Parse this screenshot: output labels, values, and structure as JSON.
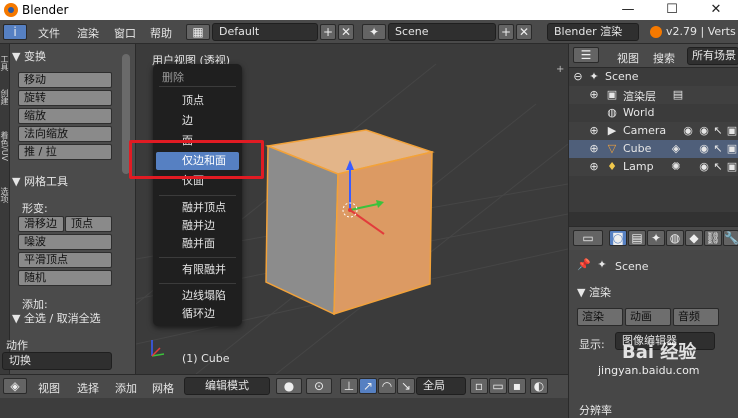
{
  "window": {
    "title": "Blender",
    "min_glyph": "—",
    "max_glyph": "☐",
    "close_glyph": "✕"
  },
  "topbar": {
    "info_glyph": "i",
    "menu": [
      "文件",
      "渲染",
      "窗口",
      "帮助"
    ],
    "layout_value": "Default",
    "scene_value": "Scene",
    "engine_value": "Blender 渲染",
    "version": "v2.79 | Verts",
    "plus": "+",
    "x": "✕"
  },
  "toolshelf": {
    "tabs": [
      "工具",
      "创建",
      "着色/UV",
      "选项"
    ],
    "transform_header": "▼ 变换",
    "transform_buttons": [
      "移动",
      "旋转",
      "缩放",
      "法向缩放",
      "推 / 拉"
    ],
    "mesh_tools_header": "▼ 网格工具",
    "deform_label": "形变:",
    "deform_buttons": [
      "滑移边",
      "顶点",
      "噪波",
      "平滑顶点",
      "随机"
    ],
    "add_label": "添加:",
    "select_header": "▼ 全选 / 取消全选",
    "action_label": "动作",
    "action_value": "切换"
  },
  "viewport": {
    "title": "用户视图 (透视)",
    "object_label": "(1) Cube"
  },
  "delete_menu": {
    "title": "删除",
    "items": [
      "顶点",
      "边",
      "面",
      "仅边和面",
      "仅面",
      "融并顶点",
      "融并边",
      "融并面",
      "有限融并",
      "边线塌陷",
      "循环边"
    ],
    "active_index": 3
  },
  "bottombar": {
    "menu": [
      "视图",
      "选择",
      "添加",
      "网格"
    ],
    "mode_value": "编辑模式",
    "pivot_value": "全局"
  },
  "outliner": {
    "header": [
      "视图",
      "搜索",
      "所有场景"
    ],
    "rows": [
      {
        "label": "Scene",
        "indent": 0
      },
      {
        "label": "渲染层",
        "indent": 1
      },
      {
        "label": "World",
        "indent": 1
      },
      {
        "label": "Camera",
        "indent": 1
      },
      {
        "label": "Cube",
        "indent": 1
      },
      {
        "label": "Lamp",
        "indent": 1
      }
    ]
  },
  "properties": {
    "scene_label": "Scene",
    "render_header": "▼ 渲染",
    "render_buttons": [
      "渲染",
      "动画",
      "音频"
    ],
    "display_label": "显示:",
    "display_value": "图像编辑器",
    "resolution_label": "分辨率"
  },
  "watermark": {
    "text": "Bai 经验",
    "url": "jingyan.baidu.com"
  },
  "colors": {
    "accent": "#5680c2",
    "cube_orange": "#e8a36b",
    "highlight_red": "#e11b23"
  }
}
